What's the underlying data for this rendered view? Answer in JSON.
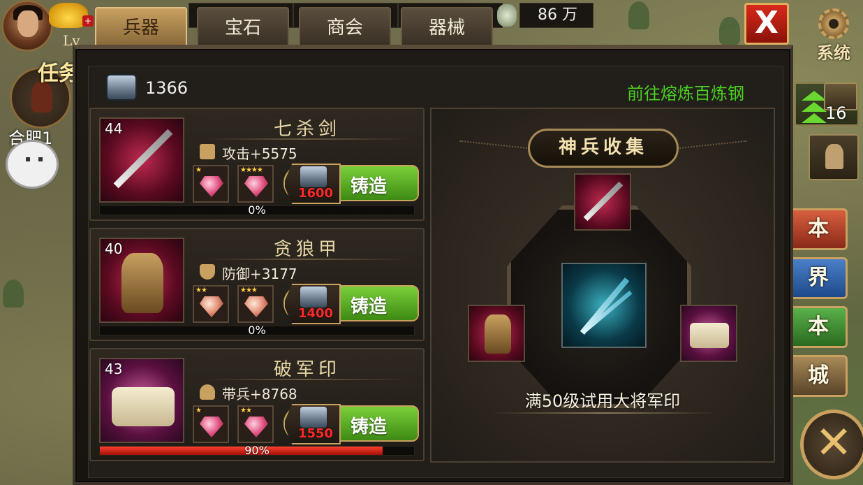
{
  "hud": {
    "level_label": "Lv",
    "resource_value": "86 万"
  },
  "tabs": [
    {
      "label": "兵器",
      "active": true
    },
    {
      "label": "宝石",
      "active": false
    },
    {
      "label": "商会",
      "active": false
    },
    {
      "label": "器械",
      "active": false
    }
  ],
  "close_label": "X",
  "system_label": "系统",
  "left_panel": {
    "task_label": "任务",
    "city_label": "合肥1"
  },
  "right_panel": {
    "chest_count": "16",
    "side_buttons": [
      "本",
      "界",
      "本",
      "城"
    ],
    "side_button_colors": [
      "#b8482a",
      "#2a5a9a",
      "#3a8a3a",
      "#8a6a3a"
    ]
  },
  "forge_panel": {
    "steel_count": "1366",
    "goto_label": "前往熔炼百炼钢",
    "items": [
      {
        "level": "44",
        "name": "七杀剑",
        "stat": "攻击+5575",
        "stat_icon": "sword-icon",
        "gems": [
          {
            "stars": "★"
          },
          {
            "stars": "★★★★"
          }
        ],
        "cost": "1600",
        "forge_label": "铸造",
        "progress_label": "0%",
        "progress_value": 0
      },
      {
        "level": "40",
        "name": "贪狼甲",
        "stat": "防御+3177",
        "stat_icon": "shield-icon",
        "gems": [
          {
            "stars": "★★"
          },
          {
            "stars": "★★★"
          }
        ],
        "cost": "1400",
        "forge_label": "铸造",
        "progress_label": "0%",
        "progress_value": 0
      },
      {
        "level": "43",
        "name": "破军印",
        "stat": "带兵+8768",
        "stat_icon": "troops-icon",
        "gems": [
          {
            "stars": "★"
          },
          {
            "stars": "★★"
          }
        ],
        "cost": "1550",
        "forge_label": "铸造",
        "progress_label": "90%",
        "progress_value": 0.9
      }
    ]
  },
  "collection": {
    "title": "神兵收集",
    "caption": "满50级试用大将军印"
  },
  "colors": {
    "accent_green": "#4ad020",
    "cost_red": "#ff2a2a",
    "progress_red": "#e02010"
  }
}
